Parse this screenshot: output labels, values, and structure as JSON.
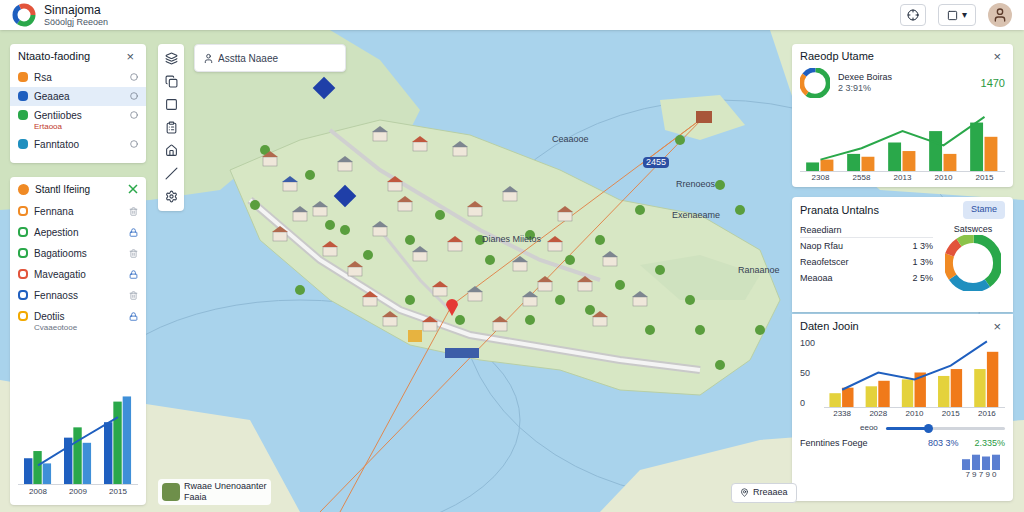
{
  "app": {
    "title": "Sinnajoma",
    "subtitle": "Sööolgj Reeoen",
    "caret": "▾"
  },
  "layers_panel": {
    "title": "Ntaato-faoding",
    "close": "×",
    "items": [
      {
        "label": "Rsa",
        "sublabel": "",
        "selected": false,
        "color": "#f08a24"
      },
      {
        "label": "Geaaea",
        "sublabel": "",
        "selected": true,
        "color": "#1f5fbf"
      },
      {
        "label": "Gentiiobes",
        "sublabel": "Ertaooa",
        "selected": false,
        "color": "#2aa84a"
      },
      {
        "label": "Fanntatoo",
        "sublabel": "",
        "selected": false,
        "color": "#1f8fbf"
      }
    ]
  },
  "filter_panel": {
    "title": "Stantl Ifeiing",
    "items": [
      {
        "label": "Fennana",
        "sublabel": "",
        "color": "#f08a24"
      },
      {
        "label": "Aepestion",
        "sublabel": "",
        "color": "#2aa84a"
      },
      {
        "label": "Bagatiooms",
        "sublabel": "",
        "color": "#2aa84a"
      },
      {
        "label": "Maveagatio",
        "sublabel": "",
        "color": "#e2543b"
      },
      {
        "label": "Fennaoss",
        "sublabel": "",
        "color": "#1f5fbf"
      },
      {
        "label": "Deotiis",
        "sublabel": "Cvaaeotooe",
        "color": "#f2a900"
      }
    ],
    "chart": {
      "labels": [
        "2008",
        "2009",
        "2015"
      ],
      "max": 100,
      "series": [
        {
          "color": "#1f5fbf",
          "values": [
            25,
            45,
            60
          ]
        },
        {
          "color": "#2aa84a",
          "values": [
            32,
            55,
            80
          ]
        },
        {
          "color": "#3f8fd8",
          "values": [
            20,
            40,
            85
          ]
        }
      ],
      "line": {
        "color": "#1f5fbf",
        "values": [
          18,
          42,
          65
        ]
      }
    }
  },
  "search": {
    "placeholder": "Asstta Naaee"
  },
  "map_labels": [
    {
      "text": "Ceaaooe",
      "kind": "text"
    },
    {
      "text": "2455",
      "kind": "badge"
    },
    {
      "text": "Dianes Miietos",
      "kind": "text"
    },
    {
      "text": "Rrenoeos",
      "kind": "text"
    },
    {
      "text": "Exenaeame",
      "kind": "text"
    },
    {
      "text": "Ranaanoe",
      "kind": "text"
    }
  ],
  "legend_card": {
    "title": "Rwaae Unenoaanter",
    "subtitle": "Faaia"
  },
  "map_button": {
    "label": "Rreaaea"
  },
  "stats_panel": {
    "title": "Raeodp Utame",
    "close": "×",
    "name": "Dexee Boiras",
    "detail": "2 3:91%",
    "value": "1470",
    "donut": [
      {
        "value": 60,
        "color": "#2aa84a"
      },
      {
        "value": 25,
        "color": "#f08a24"
      },
      {
        "value": 15,
        "color": "#1f5fbf"
      }
    ],
    "chart": {
      "labels": [
        "2308",
        "2558",
        "2013",
        "2010",
        "2015"
      ],
      "max": 100,
      "series": [
        {
          "color": "#2aa84a",
          "values": [
            15,
            30,
            50,
            70,
            85
          ]
        },
        {
          "color": "#f08a24",
          "values": [
            20,
            25,
            35,
            30,
            60
          ]
        }
      ],
      "line": {
        "color": "#2aa84a",
        "values": [
          20,
          40,
          70,
          45,
          95
        ]
      }
    }
  },
  "status_panel": {
    "title": "Pranata Untalns",
    "button": "Stame",
    "list_header": "Reaediarn",
    "rows": [
      {
        "label": "Naop Rfau",
        "value": "1 3%"
      },
      {
        "label": "Reaofetscer",
        "value": "1 3%"
      },
      {
        "label": "Meaoaa",
        "value": "2 5%"
      }
    ],
    "donut_title": "Satswces",
    "donut": [
      {
        "value": 40,
        "color": "#2aa84a"
      },
      {
        "value": 25,
        "color": "#1f8fbf"
      },
      {
        "value": 15,
        "color": "#f08a24"
      },
      {
        "value": 10,
        "color": "#e2543b"
      },
      {
        "value": 10,
        "color": "#8bc34a"
      }
    ]
  },
  "data_panel": {
    "title": "Daten Jooin",
    "close": "×",
    "ticks": [
      "100",
      "50",
      "0"
    ],
    "chart": {
      "labels": [
        "2338",
        "2028",
        "2010",
        "2015",
        "2016"
      ],
      "max": 100,
      "series": [
        {
          "color": "#e4d23c",
          "values": [
            20,
            30,
            40,
            45,
            55
          ]
        },
        {
          "color": "#f07a1a",
          "values": [
            28,
            38,
            50,
            55,
            80
          ]
        }
      ],
      "line": {
        "color": "#1f5fbf",
        "values": [
          25,
          50,
          40,
          60,
          95
        ]
      }
    },
    "slider": {
      "label": "eeoo",
      "level": 0.35
    },
    "summary": {
      "label": "Fenntines Foege",
      "value": "803 3%",
      "change": "2.335%"
    },
    "mini_bars": {
      "color": "#5b7fd1",
      "values": [
        60,
        85,
        75,
        85
      ],
      "caption": "7 9 7 9 0"
    }
  }
}
